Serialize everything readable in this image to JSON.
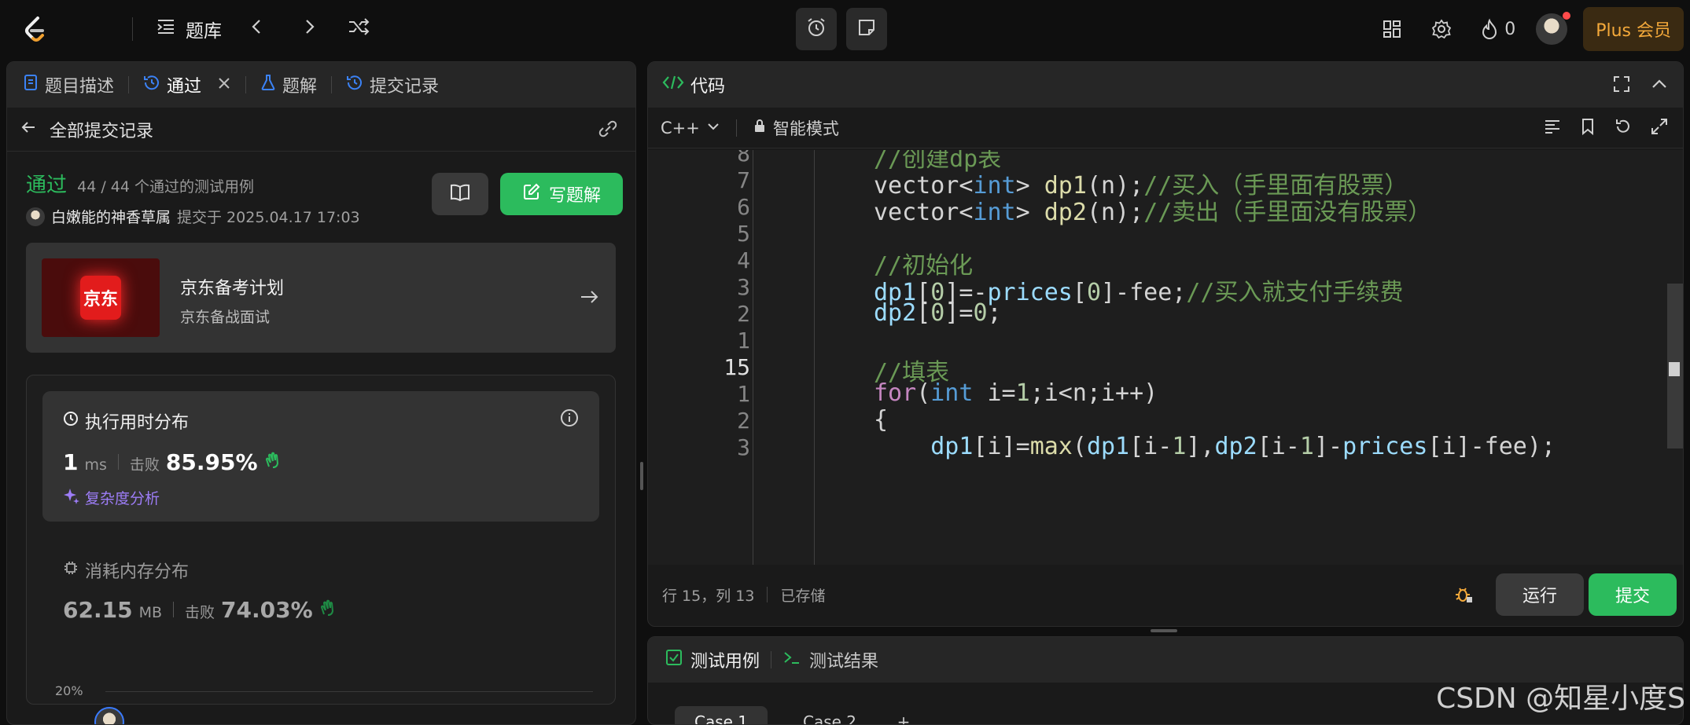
{
  "topbar": {
    "qbank_label": "题库",
    "coins": "0",
    "plus_label": "Plus 会员"
  },
  "left": {
    "tabs": [
      {
        "label": "题目描述"
      },
      {
        "label": "通过"
      },
      {
        "label": "题解"
      },
      {
        "label": "提交记录"
      }
    ],
    "back_label": "全部提交记录",
    "result": {
      "status": "通过",
      "cases": "44 / 44 个通过的测试用例",
      "user": "白嫩能的神香草属",
      "submitted": "提交于 2025.04.17 17:03",
      "write_label": "写题解"
    },
    "ad": {
      "logo_text": "京东",
      "title": "京东备考计划",
      "subtitle": "京东备战面试"
    },
    "runtime": {
      "title": "执行用时分布",
      "value": "1",
      "unit": "ms",
      "beat_label": "击败",
      "beat_pct": "85.95%",
      "complexity_label": "复杂度分析"
    },
    "memory": {
      "title": "消耗内存分布",
      "value": "62.15",
      "unit": "MB",
      "beat_label": "击败",
      "beat_pct": "74.03%"
    },
    "chart_axis_label": "20%"
  },
  "code": {
    "title": "代码",
    "language": "C++",
    "mode": "智能模式",
    "lines": [
      {
        "no": "8",
        "html": "<span class=\"c-cm\">//创建dp表</span>"
      },
      {
        "no": "7",
        "html": "vector&lt;<span class=\"c-kw\">int</span>&gt; <span class=\"c-fn\">dp1</span>(n);<span class=\"c-cm\">//买入（手里面有股票）</span>"
      },
      {
        "no": "6",
        "html": "vector&lt;<span class=\"c-kw\">int</span>&gt; <span class=\"c-fn\">dp2</span>(n);<span class=\"c-cm\">//卖出（手里面没有股票）</span>"
      },
      {
        "no": "5",
        "html": ""
      },
      {
        "no": "4",
        "html": "<span class=\"c-cm\">//初始化</span>"
      },
      {
        "no": "3",
        "html": "<span class=\"c-id\">dp1</span>[<span class=\"c-num\">0</span>]=-<span class=\"c-id\">prices</span>[<span class=\"c-num\">0</span>]-fee;<span class=\"c-cm\">//买入就支付手续费</span>"
      },
      {
        "no": "2",
        "html": "<span class=\"c-id\">dp2</span>[<span class=\"c-num\">0</span>]=<span class=\"c-num\">0</span>;"
      },
      {
        "no": "1",
        "html": ""
      },
      {
        "no": "15",
        "html": "<span class=\"c-cm\">//填表</span>"
      },
      {
        "no": "1",
        "html": "<span class=\"c-ctl\">for</span>(<span class=\"c-kw\">int</span> i=<span class=\"c-num\">1</span>;i&lt;n;i++)"
      },
      {
        "no": "2",
        "html": "{"
      },
      {
        "no": "3",
        "html": "    <span class=\"c-id\">dp1</span>[i]=<span class=\"c-fn\">max</span>(<span class=\"c-id\">dp1</span>[i-<span class=\"c-num\">1</span>],<span class=\"c-id\">dp2</span>[i-<span class=\"c-num\">1</span>]-<span class=\"c-id\">prices</span>[i]-fee);"
      }
    ],
    "cursor": "行 15，列 13",
    "saved": "已存储",
    "run_label": "运行",
    "submit_label": "提交"
  },
  "test": {
    "cases_label": "测试用例",
    "result_label": "测试结果",
    "case_tabs": [
      "Case 1",
      "Case 2"
    ],
    "add_label": "+"
  },
  "watermark": "CSDN @知星小度S",
  "colors": {
    "accent_green": "#2cbb5d",
    "plus_gold": "#f4a93a",
    "ai_purple": "#9d7df7"
  }
}
